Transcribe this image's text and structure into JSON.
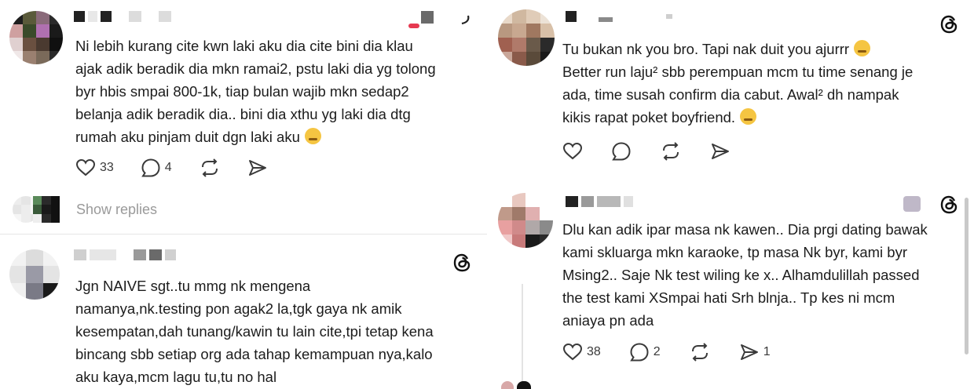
{
  "posts": [
    {
      "id": "p1",
      "lines": [
        "Ni lebih kurang cite kwn laki aku dia cite bini dia klau",
        "ajak adik beradik dia mkn ramai2, pstu laki dia yg tolong",
        "byr hbis smpai 800-1k, tiap bulan wajib mkn sedap2",
        "belanja adik beradik dia.. bini dia xthu yg laki dia dtg",
        "rumah aku pinjam duit dgn laki aku"
      ],
      "emoji": "relieved-face",
      "likes": "33",
      "comments": "4",
      "reposts": "",
      "shares": "",
      "show_replies": "Show replies"
    },
    {
      "id": "p2",
      "lines": [
        "Jgn NAIVE sgt..tu mmg nk mengena",
        "namanya,nk.testing pon agak2 la,tgk gaya nk amik",
        "kesempatan,dah tunang/kawin tu lain cite,tpi tetap kena",
        "bincang sbb setiap org ada tahap kemampuan nya,kalo",
        "aku kaya,mcm lagu tu,tu no hal"
      ]
    },
    {
      "id": "p3",
      "lines": [
        "Tu bukan nk you bro. Tapi nak duit you ajurrr",
        "Better run laju² sbb perempuan mcm tu time senang je",
        "ada, time susah confirm dia cabut. Awal² dh nampak",
        "kikis rapat poket boyfriend."
      ],
      "likes": "",
      "comments": "",
      "reposts": "",
      "shares": ""
    },
    {
      "id": "p4",
      "lines": [
        "Dlu kan adik ipar masa nk kawen.. Dia prgi dating bawak",
        "kami skluarga mkn karaoke, tp  masa Nk byr, kami byr",
        "Msing2.. Saje Nk test wiling ke x.. Alhamdulillah passed",
        "the test kami XSmpai hati Srh blnja.. Tp kes ni mcm",
        "aniaya pn ada"
      ],
      "likes": "38",
      "comments": "2",
      "reposts": "",
      "shares": "1"
    }
  ],
  "icons": {
    "like": "heart-icon",
    "comment": "comment-bubble-icon",
    "repost": "repost-icon",
    "share": "send-icon",
    "brand": "threads-logo-icon"
  },
  "colors": {
    "text": "#1c1c1c",
    "muted": "#9a9a9a",
    "emoji": "#f5c542"
  }
}
